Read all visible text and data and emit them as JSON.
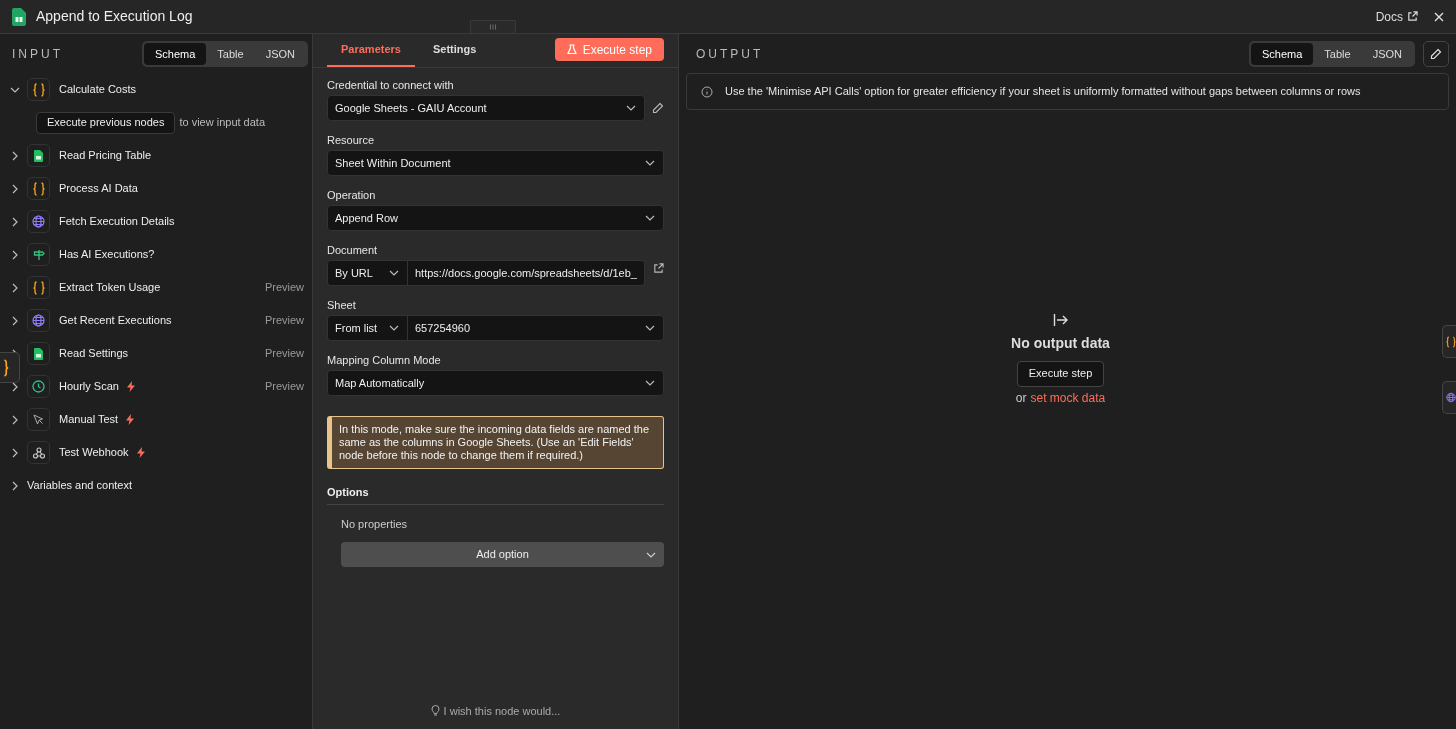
{
  "window": {
    "title": "Append to Execution Log",
    "docs_link": "Docs"
  },
  "input": {
    "heading": "INPUT",
    "view_tabs": [
      {
        "label": "Schema",
        "selected": true
      },
      {
        "label": "Table",
        "selected": false
      },
      {
        "label": "JSON",
        "selected": false
      }
    ],
    "nodes": [
      {
        "name": "Calculate Costs",
        "kind": "code",
        "expanded": true,
        "trigger": false,
        "hint_button": "Execute previous nodes",
        "hint_text": "to view input data"
      },
      {
        "name": "Read Pricing Table",
        "kind": "sheets",
        "expanded": false,
        "trigger": false
      },
      {
        "name": "Process AI Data",
        "kind": "code",
        "expanded": false,
        "trigger": false
      },
      {
        "name": "Fetch Execution Details",
        "kind": "globe",
        "expanded": false,
        "trigger": false
      },
      {
        "name": "Has AI Executions?",
        "kind": "if",
        "expanded": false,
        "trigger": false
      },
      {
        "name": "Extract Token Usage",
        "kind": "code",
        "expanded": false,
        "trigger": false,
        "badge": "Preview"
      },
      {
        "name": "Get Recent Executions",
        "kind": "globe",
        "expanded": false,
        "trigger": false,
        "badge": "Preview"
      },
      {
        "name": "Read Settings",
        "kind": "sheets",
        "expanded": false,
        "trigger": false,
        "badge": "Preview"
      },
      {
        "name": "Hourly Scan",
        "kind": "clock",
        "expanded": false,
        "trigger": true,
        "badge": "Preview"
      },
      {
        "name": "Manual Test",
        "kind": "cursor",
        "expanded": false,
        "trigger": true
      },
      {
        "name": "Test Webhook",
        "kind": "webhook",
        "expanded": false,
        "trigger": true
      }
    ],
    "variables": "Variables and context"
  },
  "node_panel": {
    "tabs": [
      {
        "label": "Parameters",
        "selected": true
      },
      {
        "label": "Settings",
        "selected": false
      }
    ],
    "execute_button": "Execute step",
    "fields": [
      {
        "label": "Credential to connect with",
        "kind": "select",
        "value": "Google Sheets - GAIU Account",
        "editable": true
      },
      {
        "label": "Resource",
        "kind": "select",
        "value": "Sheet Within Document"
      },
      {
        "label": "Operation",
        "kind": "select",
        "value": "Append Row"
      },
      {
        "label": "Document",
        "kind": "locator",
        "mode": "By URL",
        "value": "https://docs.google.com/spreadsheets/d/1eb_",
        "open_link": true
      },
      {
        "label": "Sheet",
        "kind": "locator_select",
        "mode": "From list",
        "value": "657254960"
      },
      {
        "label": "Mapping Column Mode",
        "kind": "select",
        "value": "Map Automatically"
      }
    ],
    "notice": "In this mode, make sure the incoming data fields are named the same as the columns in Google Sheets. (Use an 'Edit Fields' node before this node to change them if required.)",
    "options": {
      "heading": "Options",
      "empty": "No properties",
      "add_button": "Add option"
    },
    "feedback": "I wish this node would..."
  },
  "output": {
    "heading": "OUTPUT",
    "view_tabs": [
      {
        "label": "Schema",
        "selected": true
      },
      {
        "label": "Table",
        "selected": false
      },
      {
        "label": "JSON",
        "selected": false
      }
    ],
    "tip": "Use the 'Minimise API Calls' option for greater efficiency if your sheet is uniformly formatted without gaps between columns or rows",
    "empty": {
      "title": "No output data",
      "button": "Execute step",
      "or": "or",
      "link": "set mock data"
    }
  },
  "side_tabs": [
    {
      "kind": "code"
    },
    {
      "kind": "globe"
    }
  ]
}
